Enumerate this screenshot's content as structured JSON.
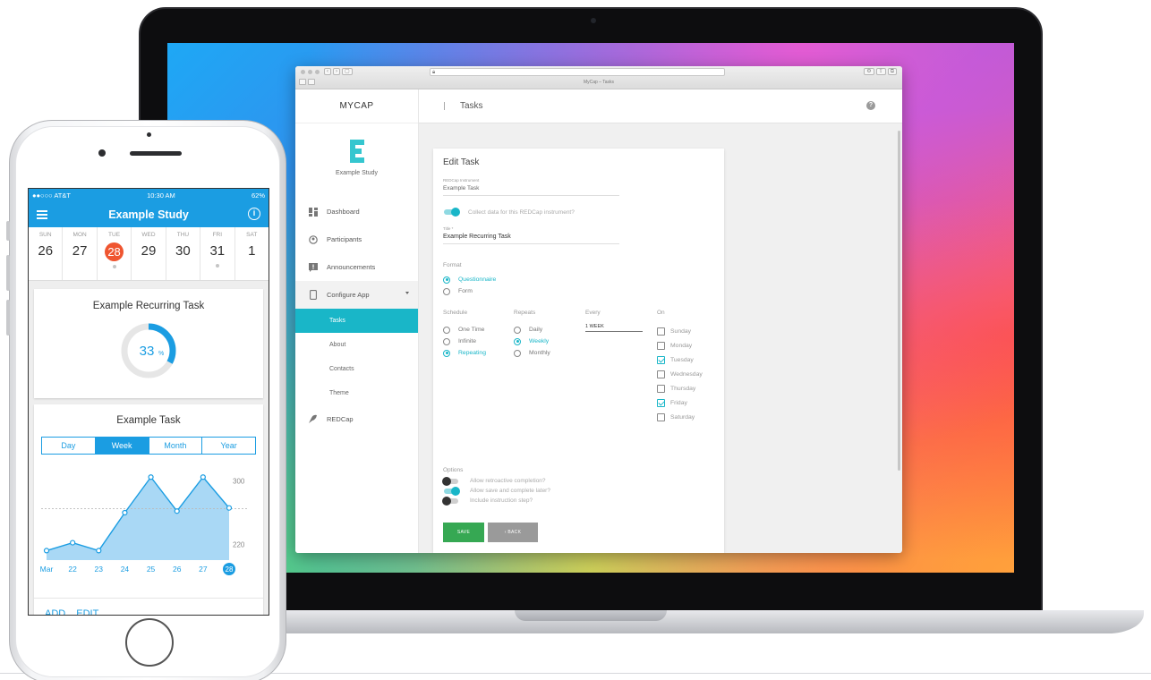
{
  "browser": {
    "tab_title": "MyCap – Tasks",
    "brand": "MYCAP",
    "study_name": "Example Study",
    "breadcrumb": "Tasks",
    "menu": [
      {
        "label": "Dashboard",
        "icon": "dashboard-icon"
      },
      {
        "label": "Participants",
        "icon": "participants-icon"
      },
      {
        "label": "Announcements",
        "icon": "announcements-icon"
      },
      {
        "label": "Configure App",
        "icon": "phone-icon"
      }
    ],
    "submenu": [
      "Tasks",
      "About",
      "Contacts",
      "Theme"
    ],
    "redcap_label": "REDCap",
    "edit_task": {
      "title": "Edit Task",
      "instrument_label": "REDCap Instrument",
      "instrument_value": "Example Task",
      "collect_label": "Collect data for this REDCap instrument?",
      "title_label": "Title *",
      "title_value": "Example Recurring Task",
      "format_label": "Format",
      "format_options": [
        "Questionnaire",
        "Form"
      ],
      "schedule_label": "Schedule",
      "schedule_options": [
        "One Time",
        "Infinite",
        "Repeating"
      ],
      "repeats_label": "Repeats",
      "repeats_options": [
        "Daily",
        "Weekly",
        "Monthly"
      ],
      "every_label": "Every",
      "every_value": "1 WEEK",
      "on_label": "On",
      "days": [
        "Sunday",
        "Monday",
        "Tuesday",
        "Wednesday",
        "Thursday",
        "Friday",
        "Saturday"
      ],
      "days_checked": [
        false,
        false,
        true,
        false,
        false,
        true,
        false
      ],
      "options_label": "Options",
      "options": [
        {
          "label": "Allow retroactive completion?",
          "on": false
        },
        {
          "label": "Allow save and complete later?",
          "on": true
        },
        {
          "label": "Include instruction step?",
          "on": false
        }
      ],
      "save_label": "SAVE",
      "back_label": "‹ BACK"
    }
  },
  "phone": {
    "status_carrier": "●●○○○ AT&T",
    "status_time": "10:30 AM",
    "status_battery": "62%",
    "title": "Example Study",
    "week": [
      {
        "name": "SUN",
        "num": "26"
      },
      {
        "name": "MON",
        "num": "27"
      },
      {
        "name": "TUE",
        "num": "28"
      },
      {
        "name": "WED",
        "num": "29"
      },
      {
        "name": "THU",
        "num": "30"
      },
      {
        "name": "FRI",
        "num": "31"
      },
      {
        "name": "SAT",
        "num": "1"
      }
    ],
    "card1_title": "Example Recurring Task",
    "progress_percent": 33,
    "progress_unit": "%",
    "card2_title": "Example Task",
    "segments": [
      "Day",
      "Week",
      "Month",
      "Year"
    ],
    "actions": [
      "ADD",
      "EDIT"
    ]
  },
  "chart_data": {
    "type": "area",
    "categories": [
      "Mar",
      "22",
      "23",
      "24",
      "25",
      "26",
      "27",
      "28"
    ],
    "values": [
      212,
      222,
      212,
      260,
      305,
      262,
      305,
      266
    ],
    "ylim": [
      200,
      320
    ],
    "y_ticks": [
      "300",
      "220"
    ],
    "reference_line": 265,
    "highlight_category": "28",
    "color": "#1b9de2"
  }
}
